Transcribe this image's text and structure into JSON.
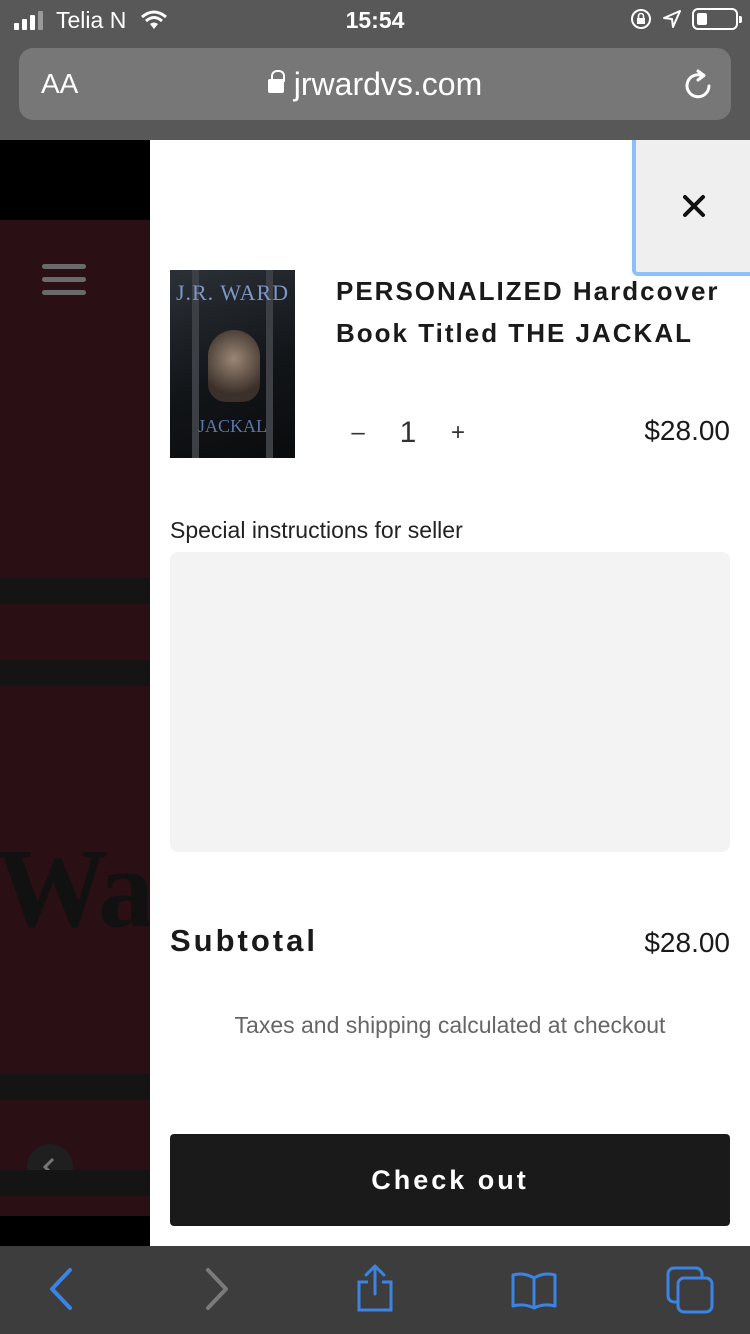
{
  "status_bar": {
    "carrier": "Telia N",
    "time": "15:54"
  },
  "browser": {
    "text_size_label": "AA",
    "url": "jrwardvs.com"
  },
  "background_page": {
    "partial_brand_text": "War"
  },
  "cart": {
    "product": {
      "cover": {
        "author": "J.R. WARD",
        "title": "JACKAL"
      },
      "title": "PERSONALIZED Hardcover Book Titled THE JACKAL",
      "quantity": "1",
      "decrease_label": "–",
      "increase_label": "+",
      "price": "$28.00"
    },
    "instructions_label": "Special instructions for seller",
    "instructions_value": "",
    "subtotal_label": "Subtotal",
    "subtotal_value": "$28.00",
    "tax_note": "Taxes and shipping calculated at checkout",
    "checkout_label": "Check out"
  },
  "icons": {
    "close": "close-icon",
    "menu": "hamburger-menu-icon",
    "back": "back-arrow-icon",
    "forward": "forward-arrow-icon",
    "share": "share-icon",
    "bookmarks": "book-icon",
    "tabs": "tabs-icon",
    "reload": "reload-icon",
    "lock": "lock-icon"
  },
  "colors": {
    "accent": "#3a84e6",
    "toolbar": "#3d3d3d",
    "checkout": "#1a1a1a",
    "backdrop": "#2a0f14"
  }
}
